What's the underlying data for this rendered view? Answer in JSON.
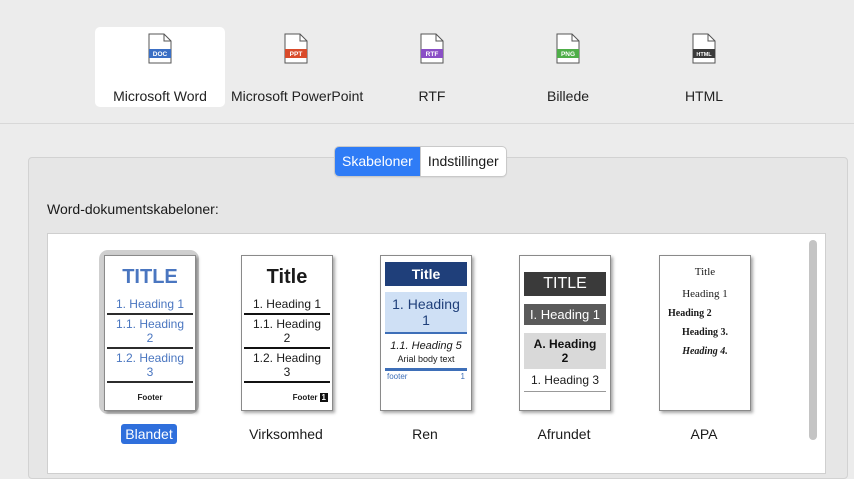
{
  "formats": [
    {
      "label": "Microsoft Word",
      "icon": "doc-file-icon",
      "badge": "DOC",
      "color": "#3b6fc4"
    },
    {
      "label": "Microsoft PowerPoint",
      "icon": "ppt-file-icon",
      "badge": "PPT",
      "color": "#d94b2b"
    },
    {
      "label": "RTF",
      "icon": "rtf-file-icon",
      "badge": "RTF",
      "color": "#8a4fc6"
    },
    {
      "label": "Billede",
      "icon": "png-file-icon",
      "badge": "PNG",
      "color": "#4fae49"
    },
    {
      "label": "HTML",
      "icon": "html-file-icon",
      "badge": "HTML",
      "color": "#3a3a3a"
    }
  ],
  "tabs": {
    "templates": "Skabeloner",
    "settings": "Indstillinger"
  },
  "section_label": "Word-dokumentskabeloner:",
  "templates": [
    {
      "name": "Blandet",
      "title": "TITLE",
      "h1": "1. Heading 1",
      "h2": "1.1. Heading 2",
      "h3": "1.2. Heading 3",
      "footer": "Footer"
    },
    {
      "name": "Virksomhed",
      "title": "Title",
      "h1": "1. Heading 1",
      "h2": "1.1. Heading 2",
      "h3": "1.2. Heading 3",
      "footer": "Footer",
      "page": "1"
    },
    {
      "name": "Ren",
      "title": "Title",
      "h1": "1. Heading 1",
      "h5": "1.1. Heading 5",
      "body": "Arial body text",
      "footer": "footer",
      "page": "1"
    },
    {
      "name": "Afrundet",
      "title": "TITLE",
      "h1": "I. Heading 1",
      "h2": "A. Heading 2",
      "h3": "1. Heading 3"
    },
    {
      "name": "APA",
      "title": "Title",
      "h1": "Heading 1",
      "h2": "Heading 2",
      "h3": "Heading 3.",
      "h4": "Heading 4."
    }
  ]
}
